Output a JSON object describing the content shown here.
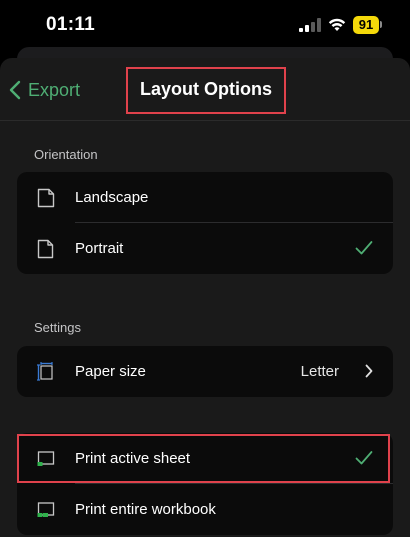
{
  "status_bar": {
    "time": "01:11",
    "battery": "91"
  },
  "nav": {
    "back_label": "Export",
    "title": "Layout Options"
  },
  "orientation": {
    "header": "Orientation",
    "items": [
      {
        "label": "Landscape",
        "selected": false
      },
      {
        "label": "Portrait",
        "selected": true
      }
    ]
  },
  "settings": {
    "header": "Settings",
    "paper_size": {
      "label": "Paper size",
      "value": "Letter"
    }
  },
  "print_scope": {
    "items": [
      {
        "label": "Print active sheet",
        "selected": true
      },
      {
        "label": "Print entire workbook",
        "selected": false
      }
    ]
  },
  "colors": {
    "accent": "#4fae74",
    "highlight": "#e0424c",
    "battery": "#f5d90a"
  }
}
